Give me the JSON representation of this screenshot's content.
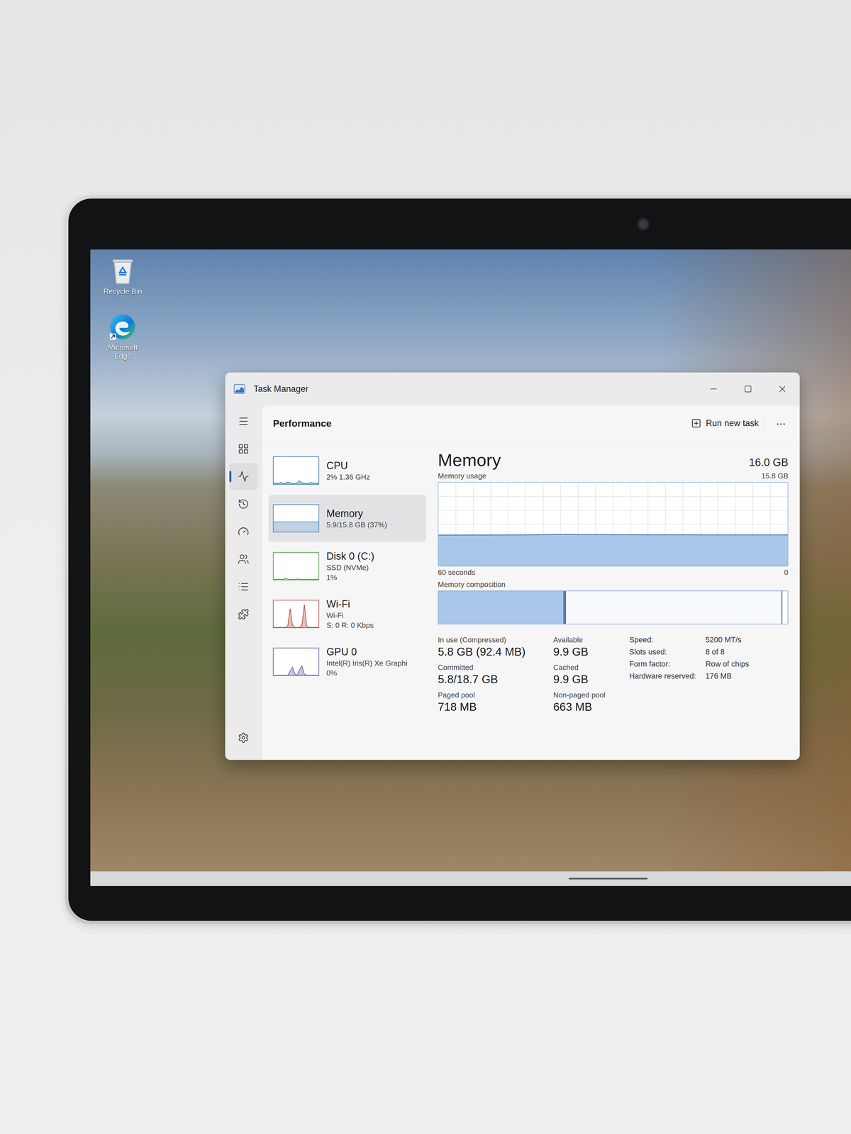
{
  "desktop": {
    "icons": [
      {
        "label": "Recycle Bin",
        "kind": "recycle"
      },
      {
        "label": "Microsoft Edge",
        "kind": "edge"
      }
    ]
  },
  "window": {
    "title": "Task Manager"
  },
  "nav": [
    {
      "kind": "menu",
      "selected": false
    },
    {
      "kind": "processes",
      "selected": false
    },
    {
      "kind": "performance",
      "selected": true
    },
    {
      "kind": "history",
      "selected": false
    },
    {
      "kind": "startup",
      "selected": false
    },
    {
      "kind": "users",
      "selected": false
    },
    {
      "kind": "details",
      "selected": false
    },
    {
      "kind": "services",
      "selected": false
    },
    {
      "kind": "settings",
      "selected": false
    }
  ],
  "header": {
    "title": "Performance",
    "run_button": "Run new task",
    "more": "···"
  },
  "devices": [
    {
      "name": "CPU",
      "lines": [
        "2% 1.36 GHz"
      ],
      "selected": false,
      "color": "#2d6db5",
      "values": [
        3,
        4,
        2,
        6,
        3,
        2,
        8,
        4,
        3,
        2,
        5,
        12,
        4,
        3,
        2,
        3,
        6,
        3,
        2,
        4
      ]
    },
    {
      "name": "Memory",
      "lines": [
        "5.9/15.8 GB (37%)"
      ],
      "selected": true,
      "color": "#4a7ab8",
      "values": [
        37,
        37,
        37,
        37,
        37,
        37,
        37,
        37,
        37,
        37,
        37,
        37,
        37,
        37,
        37,
        37,
        37,
        37,
        37,
        37
      ]
    },
    {
      "name": "Disk 0 (C:)",
      "lines": [
        "SSD (NVMe)",
        "1%"
      ],
      "selected": false,
      "color": "#4c9a3f",
      "values": [
        1,
        1,
        2,
        1,
        1,
        6,
        2,
        1,
        1,
        1,
        3,
        1,
        1,
        1,
        2,
        1,
        1,
        1,
        1,
        1
      ]
    },
    {
      "name": "Wi-Fi",
      "lines": [
        "Wi-Fi",
        "S: 0 R: 0 Kbps"
      ],
      "selected": false,
      "color": "#b0443a",
      "values": [
        0,
        0,
        0,
        0,
        0,
        0,
        5,
        70,
        8,
        0,
        0,
        0,
        10,
        85,
        6,
        0,
        0,
        0,
        0,
        0
      ]
    },
    {
      "name": "GPU 0",
      "lines": [
        "Intel(R) Iris(R) Xe Graphi",
        "0%"
      ],
      "selected": false,
      "color": "#6a4aa8",
      "values": [
        0,
        0,
        0,
        0,
        0,
        0,
        0,
        15,
        30,
        5,
        0,
        20,
        35,
        4,
        0,
        0,
        0,
        0,
        0,
        0
      ]
    }
  ],
  "detail": {
    "title": "Memory",
    "total": "16.0 GB",
    "usage_label": "Memory usage",
    "usage_max_label": "15.8 GB",
    "usage_max": 15.8,
    "usage_values": [
      5.85,
      5.85,
      5.86,
      5.86,
      5.86,
      5.87,
      5.87,
      5.88,
      5.9,
      5.93,
      5.96,
      5.95,
      5.93,
      5.92,
      5.92,
      5.91,
      5.91,
      5.9,
      5.9,
      5.9,
      5.9,
      5.9,
      5.89,
      5.89,
      5.89,
      5.88,
      5.88,
      5.88,
      5.88,
      5.88
    ],
    "time_start": "60 seconds",
    "time_end": "0",
    "composition_label": "Memory composition",
    "composition": [
      {
        "kind": "inuse",
        "level": 0.36
      },
      {
        "kind": "modified",
        "level": 0.005
      },
      {
        "kind": "standby",
        "level": 0.62
      },
      {
        "kind": "free",
        "level": 0.015
      }
    ],
    "stats": [
      {
        "label": "In use (Compressed)",
        "value": "5.8 GB (92.4 MB)"
      },
      {
        "label": "Available",
        "value": "9.9 GB"
      },
      {
        "label": "Committed",
        "value": "5.8/18.7 GB"
      },
      {
        "label": "Cached",
        "value": "9.9 GB"
      },
      {
        "label": "Paged pool",
        "value": "718 MB"
      },
      {
        "label": "Non-paged pool",
        "value": "663 MB"
      }
    ],
    "specs": [
      {
        "label": "Speed:",
        "value": "5200 MT/s"
      },
      {
        "label": "Slots used:",
        "value": "8 of 8"
      },
      {
        "label": "Form factor:",
        "value": "Row of chips"
      },
      {
        "label": "Hardware reserved:",
        "value": "176 MB"
      }
    ]
  }
}
